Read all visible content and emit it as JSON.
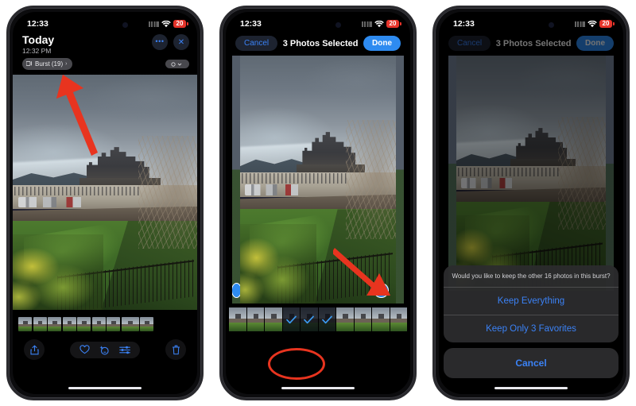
{
  "meta": {
    "scene_description": "Three iPhone screenshots showing iOS Photos burst-photo selection flow, annotated with red arrows and a red circle"
  },
  "status_bar": {
    "time": "12:33",
    "wifi_icon": "wifi-icon",
    "signal_icon": "cellular-signal-icon",
    "battery_level": "20"
  },
  "phone1": {
    "nav": {
      "title": "Today",
      "subtitle": "12:32 PM",
      "more_icon": "ellipsis-icon",
      "more_label": "•••",
      "close_icon": "close-icon",
      "close_label": "✕"
    },
    "burst_badge": {
      "icon": "burst-stack-icon",
      "label": "Burst (19)",
      "chevron": "›"
    },
    "lens_badge": {
      "label": "chevron-lens-icon"
    },
    "toolbar": {
      "share_label": "share-icon",
      "favorite_label": "heart-icon",
      "enhance_label": "auto-enhance-icon",
      "adjust_label": "adjust-sliders-icon",
      "trash_label": "trash-icon"
    },
    "annotation": {
      "arrow": "red-arrow-pointing-to-burst-badge"
    }
  },
  "phone2": {
    "nav": {
      "cancel_label": "Cancel",
      "title": "3 Photos Selected",
      "done_label": "Done"
    },
    "selected_badge": {
      "icon": "checkmark-circle-icon"
    },
    "filmstrip": {
      "total_thumbs": 10,
      "selected_indices": [
        3,
        4,
        5
      ],
      "check_icon": "checkmark-icon"
    },
    "annotation": {
      "arrow": "red-arrow-pointing-to-checkmark-badge",
      "circle": "red-circle-around-selected-thumbnails"
    }
  },
  "phone3": {
    "nav": {
      "cancel_label": "Cancel",
      "title": "3 Photos Selected",
      "done_label": "Done"
    },
    "action_sheet": {
      "message": "Would you like to keep the other 16 photos in this burst?",
      "options": [
        "Keep Everything",
        "Keep Only 3 Favorites"
      ],
      "cancel_label": "Cancel"
    }
  },
  "colors": {
    "accent_blue": "#3b82f6",
    "done_blue": "#2e8bf0",
    "annotation_red": "#e8341f",
    "battery_red": "#e5332a",
    "sheet_bg": "#2c2c2e"
  }
}
